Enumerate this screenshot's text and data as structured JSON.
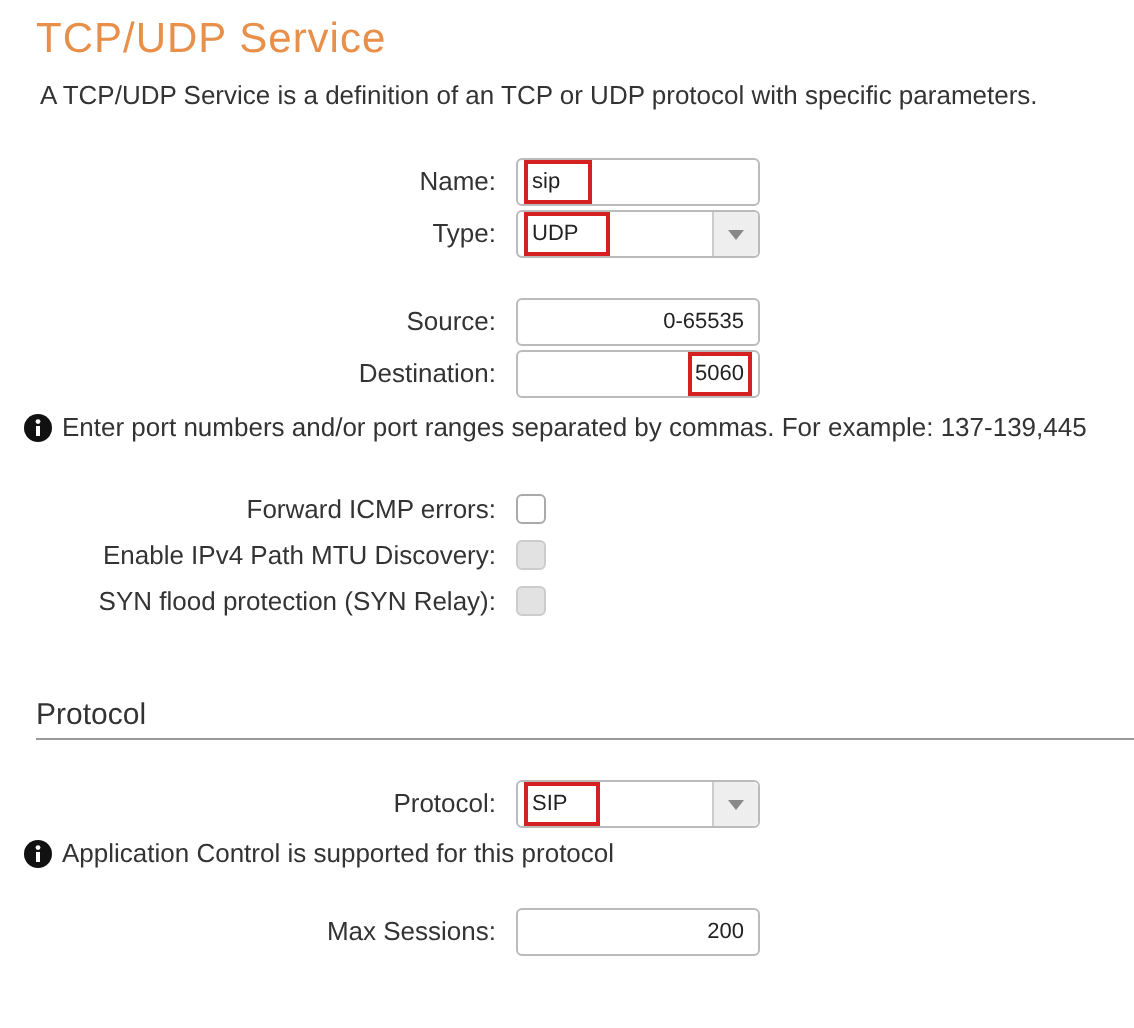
{
  "title": "TCP/UDP Service",
  "description": "A TCP/UDP Service is a definition of an TCP or UDP protocol with specific parameters.",
  "fields": [
    {
      "label": "Name:",
      "kind": "text",
      "value": "sip",
      "highlighted": true
    },
    {
      "label": "Type:",
      "kind": "select",
      "value": "UDP",
      "highlighted": true
    }
  ],
  "ports": [
    {
      "label": "Source:",
      "kind": "number",
      "value": "0-65535",
      "highlighted": false
    },
    {
      "label": "Destination:",
      "kind": "number",
      "value": "5060",
      "highlighted": true
    }
  ],
  "ports_info": "Enter port numbers and/or port ranges separated by commas. For example: 137-139,445",
  "options": [
    {
      "label": "Forward ICMP errors:",
      "checked": false,
      "disabled": false
    },
    {
      "label": "Enable IPv4 Path MTU Discovery:",
      "checked": false,
      "disabled": true
    },
    {
      "label": "SYN flood protection (SYN Relay):",
      "checked": false,
      "disabled": true
    }
  ],
  "protocol_section": {
    "heading": "Protocol",
    "fields": [
      {
        "label": "Protocol:",
        "kind": "select",
        "value": "SIP",
        "highlighted": true
      }
    ],
    "info": "Application Control is supported for this protocol",
    "limits": [
      {
        "label": "Max Sessions:",
        "kind": "number",
        "value": "200",
        "highlighted": false
      }
    ]
  }
}
